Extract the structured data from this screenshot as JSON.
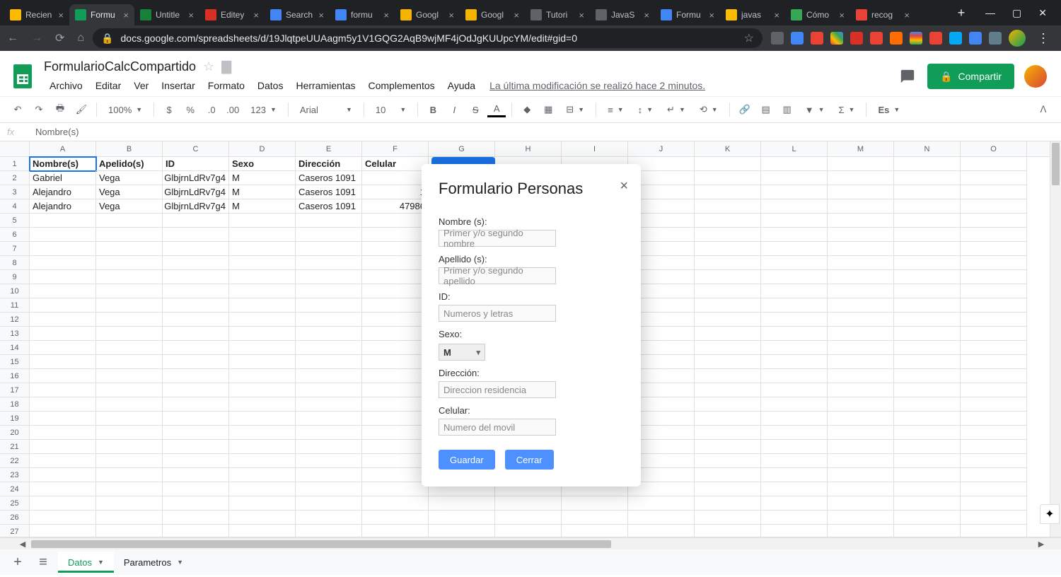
{
  "browser": {
    "tabs": [
      {
        "label": "Recien",
        "favicon": "#ffba00"
      },
      {
        "label": "Formu",
        "favicon": "#0f9d58",
        "active": true
      },
      {
        "label": "Untitle",
        "favicon": "#188038"
      },
      {
        "label": "Editey",
        "favicon": "#d93025"
      },
      {
        "label": "Search",
        "favicon": "#4285f4"
      },
      {
        "label": "formu",
        "favicon": "#4285f4"
      },
      {
        "label": "Googl",
        "favicon": "#f4b400"
      },
      {
        "label": "Googl",
        "favicon": "#f4b400"
      },
      {
        "label": "Tutori",
        "favicon": "#5f6368"
      },
      {
        "label": "JavaS",
        "favicon": "#5f6368"
      },
      {
        "label": "Formu",
        "favicon": "#4285f4"
      },
      {
        "label": "javas",
        "favicon": "#fbbc04"
      },
      {
        "label": "Cómo",
        "favicon": "#34a853"
      },
      {
        "label": "recog",
        "favicon": "#ea4335"
      }
    ],
    "url": "docs.google.com/spreadsheets/d/19JlqtpeUUAagm5y1V1GQG2AqB9wjMF4jOdJgKUUpcYM/edit#gid=0"
  },
  "doc": {
    "title": "FormularioCalcCompartido",
    "menus": [
      "Archivo",
      "Editar",
      "Ver",
      "Insertar",
      "Formato",
      "Datos",
      "Herramientas",
      "Complementos",
      "Ayuda"
    ],
    "last_mod": "La última modificación se realizó hace 2 minutos.",
    "share": "Compartir"
  },
  "toolbar": {
    "zoom": "100%",
    "number_format": "123",
    "font": "Arial",
    "size": "10",
    "lang": "Es"
  },
  "fx": {
    "value": "Nombre(s)"
  },
  "grid": {
    "cols": [
      "A",
      "B",
      "C",
      "D",
      "E",
      "F",
      "G",
      "H",
      "I",
      "J",
      "K",
      "L",
      "M",
      "N",
      "O"
    ],
    "headers": [
      "Nombre(s)",
      "Apelido(s)",
      "ID",
      "Sexo",
      "Dirección",
      "Celular"
    ],
    "rows": [
      [
        "Gabriel",
        "Vega",
        "GlbjrnLdRv7g4",
        "M",
        "Caseros 1091",
        ""
      ],
      [
        "Alejandro",
        "Vega",
        "GlbjrnLdRv7g4",
        "M",
        "Caseros 1091",
        "1"
      ],
      [
        "Alejandro",
        "Vega",
        "GlbjrnLdRv7g4",
        "M",
        "Caseros 1091",
        "47986"
      ]
    ],
    "total_rows": 28
  },
  "sheets": {
    "tabs": [
      {
        "name": "Datos",
        "active": true
      },
      {
        "name": "Parametros",
        "active": false
      }
    ]
  },
  "dialog": {
    "title": "Formulario Personas",
    "fields": {
      "nombre_label": "Nombre (s):",
      "nombre_ph": "Primer y/o segundo nombre",
      "apellido_label": "Apellido (s):",
      "apellido_ph": "Primer y/o segundo apellido",
      "id_label": "ID:",
      "id_ph": "Numeros y letras",
      "sexo_label": "Sexo:",
      "sexo_value": "M",
      "direccion_label": "Dirección:",
      "direccion_ph": "Direccion residencia",
      "celular_label": "Celular:",
      "celular_ph": "Numero del movil"
    },
    "buttons": {
      "save": "Guardar",
      "close": "Cerrar"
    }
  }
}
